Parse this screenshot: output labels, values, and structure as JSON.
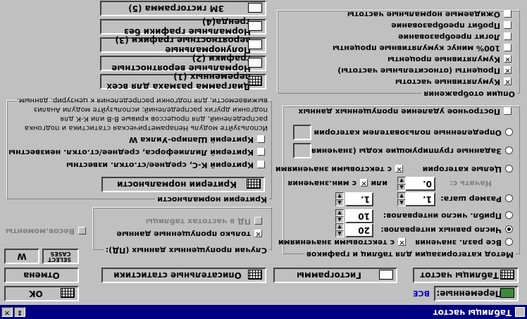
{
  "window": {
    "title": "Таблицы частот",
    "restore_glyph": "⇕",
    "close_glyph": "✕"
  },
  "toolbar": {
    "ok_label": "OK",
    "cancel_label": "Отмена",
    "variables_label": "Переменные:",
    "variables_value": "ВСЕ",
    "select_cases_label": "SELECT CASES",
    "weight_label": "W"
  },
  "outputs": {
    "frequency_tables": "Таблицы частот",
    "histograms": "Гистограммы",
    "descriptive_stats": "Описательные статистики"
  },
  "categorization": {
    "title": "Метод категоризации для таблиц и графиков",
    "options": [
      {
        "label": "Все разл. значения",
        "checked": false
      },
      {
        "label": "Число равных интервалов:",
        "checked": true,
        "value": "20"
      },
      {
        "label": "Прибл. число интервалов:",
        "checked": false,
        "value": "10"
      },
      {
        "label": "Размер шага:",
        "checked": false,
        "value": "1."
      },
      {
        "label": "Целые категории",
        "checked": false
      },
      {
        "label": "Заданные группирующие коды (значения)",
        "checked": false
      },
      {
        "label": "Определенные пользователем категории",
        "checked": false
      }
    ],
    "with_text_values_1": "с текстовыми значениями",
    "with_text_values_2": "с текстовыми значениями",
    "start_with_label": "Начать с:",
    "start_with_value": "0.",
    "or_label": "или",
    "min_value_label": "с мин.значения"
  },
  "missing": {
    "title": "Случаи пропущенных данных (ПД):",
    "only_missing": "только пропущенные данные",
    "md_in_freq": "ПД в частотах таблицы",
    "weights_label": "Весов.моменты"
  },
  "normality": {
    "title": "Критерии нормальности",
    "button": "Критерии нормальности",
    "tests": [
      "Критерий К-С, среднее/ст.откл. известны",
      "Критерий Лиллиефорса, среднее/ст.откл. неизвестны",
      "Критерий Шапиро-Уилка W"
    ],
    "info": [
      "Используйте модуль Непараметрическая статистика и подгонка",
      "распределений, для процессов кривые В-В или К-К для",
      "подгонки других распределений; используйте модули Анализ",
      "выживаемости, для подгонки распределения к цензурир. данным."
    ]
  },
  "display": {
    "title": "Опции отображения",
    "checkboxes": [
      {
        "label": "Кумулятивные частоты",
        "checked": true
      },
      {
        "label": "Проценты (относительные частоты)",
        "checked": true
      },
      {
        "label": "Кумулятивные проценты",
        "checked": true
      },
      {
        "label": "100% минус кумулятивные проценты",
        "checked": false
      },
      {
        "label": "Логит преобразование",
        "checked": false
      },
      {
        "label": "Пробит преобразование",
        "checked": false
      },
      {
        "label": "Ожидаемые нормальные частоты",
        "checked": false
      }
    ],
    "pairwise": "Построчное удаление пропущенных данных"
  },
  "graph_buttons": [
    "Диаграмма размаха для всех переменных (1)",
    "Нормальные вероятностные графики (2)",
    "Полунормальные вероятностные графики (3)",
    "Нормальные графики без тренда(4)",
    "3М гистограмма (5)"
  ],
  "colors": {
    "titlebar": "#000080",
    "face": "#c0c0c0",
    "variables_value": "#0000c0"
  }
}
